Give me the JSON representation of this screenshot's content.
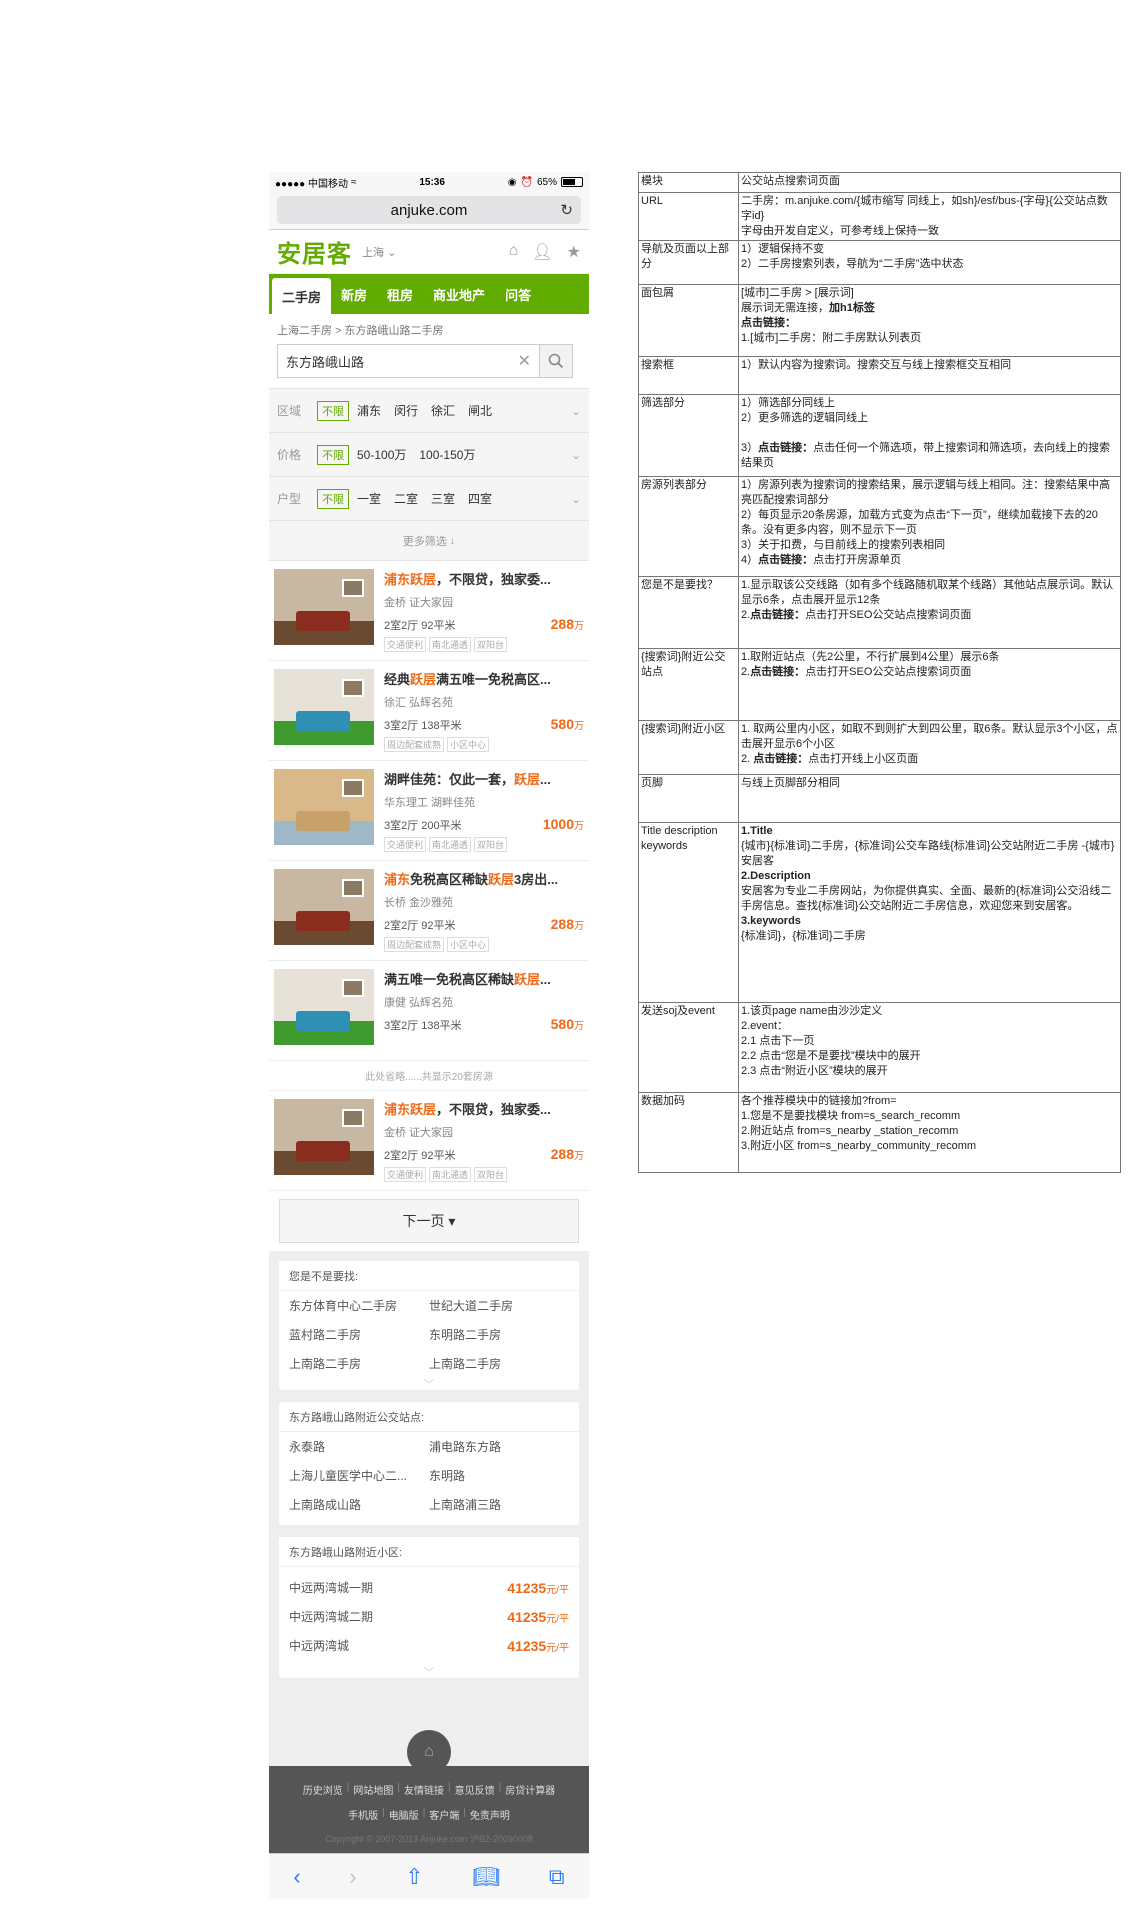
{
  "status": {
    "carrier": "●●●●● 中国移动",
    "time": "15:36",
    "battery": "65%",
    "battery_level": 0.65
  },
  "browser": {
    "url": "anjuke.com"
  },
  "site": {
    "logo": "安居客",
    "city": "上海"
  },
  "nav": {
    "tabs": [
      "二手房",
      "新房",
      "租房",
      "商业地产",
      "问答"
    ],
    "active": 0
  },
  "breadcrumb": "上海二手房 > 东方路峨山路二手房",
  "search": {
    "value": "东方路峨山路"
  },
  "filters": [
    {
      "label": "区域",
      "all": "不限",
      "options": [
        "浦东",
        "闵行",
        "徐汇",
        "闸北"
      ]
    },
    {
      "label": "价格",
      "all": "不限",
      "options": [
        "50-100万",
        "100-150万"
      ]
    },
    {
      "label": "户型",
      "all": "不限",
      "options": [
        "一室",
        "二室",
        "三室",
        "四室"
      ]
    }
  ],
  "more_filters": "更多筛选",
  "listings": [
    {
      "title_hl": "浦东跃层",
      "title_rest": "，不限贷，独家委...",
      "community": "金桥  证大家园",
      "specs": "2室2厅   92平米",
      "price": "288",
      "unit": "万",
      "tags": [
        "交通便利",
        "南北通透",
        "双阳台"
      ],
      "scene": "a"
    },
    {
      "title_pre": "经典",
      "title_hl": "跃层",
      "title_rest": "满五唯一免税高区...",
      "community": "徐汇  弘辉名苑",
      "specs": "3室2厅   138平米",
      "price": "580",
      "unit": "万",
      "tags": [
        "周边配套成熟",
        "小区中心"
      ],
      "scene": "b"
    },
    {
      "title_pre": "湖畔佳苑：仅此一套，",
      "title_hl": "跃层",
      "title_rest": "...",
      "community": "华东理工  湖畔佳苑",
      "specs": "3室2厅   200平米",
      "price": "1000",
      "unit": "万",
      "tags": [
        "交通便利",
        "南北通透",
        "双阳台"
      ],
      "scene": "c"
    },
    {
      "title_hl": "浦东",
      "title_rest": "免税高区稀缺",
      "title_hl2": "跃层",
      "title_rest2": "3房出...",
      "community": "长桥  金沙雅苑",
      "specs": "2室2厅   92平米",
      "price": "288",
      "unit": "万",
      "tags": [
        "周边配套成熟",
        "小区中心"
      ],
      "scene": "a"
    },
    {
      "title_pre": "满五唯一免税高区稀缺",
      "title_hl": "跃层",
      "title_rest": "...",
      "community": "康健  弘辉名苑",
      "specs": "3室2厅   138平米",
      "price": "580",
      "unit": "万",
      "tags": [],
      "scene": "b"
    }
  ],
  "omit_note": "此处省略......共显示20套房源",
  "last_listing": {
    "title_hl": "浦东跃层",
    "title_rest": "，不限贷，独家委...",
    "community": "金桥  证大家园",
    "specs": "2室2厅   92平米",
    "price": "288",
    "unit": "万",
    "tags": [
      "交通便利",
      "南北通透",
      "双阳台"
    ],
    "scene": "a"
  },
  "next_page": "下一页 ▾",
  "rec1": {
    "title": "您是不是要找:",
    "items": [
      "东方体育中心二手房",
      "世纪大道二手房",
      "蓝村路二手房",
      "东明路二手房",
      "上南路二手房",
      "上南路二手房"
    ]
  },
  "rec2": {
    "title": "东方路峨山路附近公交站点:",
    "items": [
      "永泰路",
      "浦电路东方路",
      "上海儿童医学中心二...",
      "东明路",
      "上南路成山路",
      "上南路浦三路"
    ]
  },
  "rec3": {
    "title": "东方路峨山路附近小区:",
    "items": [
      {
        "name": "中远两湾城一期",
        "price": "41235",
        "unit": "元/平"
      },
      {
        "name": "中远两湾城二期",
        "price": "41235",
        "unit": "元/平"
      },
      {
        "name": "中远两湾城",
        "price": "41235",
        "unit": "元/平"
      }
    ]
  },
  "footer": {
    "row1": [
      "历史浏览",
      "网站地图",
      "友情链接",
      "意见反馈",
      "房贷计算器"
    ],
    "row2": [
      "手机版",
      "电脑版",
      "客户端",
      "免责声明"
    ],
    "copyright": "Copyright © 2007-2013 Anjuke.com  沪B2-20090008"
  },
  "spec": [
    {
      "k": "模块",
      "v": [
        "公交站点搜索词页面"
      ]
    },
    {
      "k": "URL",
      "v": [
        "二手房：m.anjuke.com/{城市缩写 同线上，如sh}/esf/bus-{字母}{公交站点数字id}",
        "字母由开发自定义，可参考线上保持一致"
      ]
    },
    {
      "k": "导航及页面以上部分",
      "v": [
        "1）逻辑保持不变",
        "2）二手房搜索列表，导航为“二手房”选中状态"
      ]
    },
    {
      "k": "面包屑",
      "v": [
        "[城市]二手房 > [展示词]",
        "展示词无需连接，|加h1标签",
        "|点击链接：",
        "1.[城市]二手房：附二手房默认列表页"
      ]
    },
    {
      "k": "搜索框",
      "v": [
        "1）默认内容为搜索词。搜索交互与线上搜索框交互相同"
      ]
    },
    {
      "k": "筛选部分",
      "v": [
        "1）筛选部分同线上",
        "2）更多筛选的逻辑同线上",
        "",
        "3）|点击链接：点击任何一个筛选项，带上搜索词和筛选项，去向线上的搜索结果页"
      ]
    },
    {
      "k": "房源列表部分",
      "v": [
        "1）房源列表为搜索词的搜索结果，展示逻辑与线上相同。注：搜索结果中高亮匹配搜索词部分",
        "2）每页显示20条房源，加载方式变为点击“下一页”，继续加载接下去的20条。没有更多内容，则不显示下一页",
        "3）关于扣费，与目前线上的搜索列表相同",
        "4）|点击链接：点击打开房源单页"
      ]
    },
    {
      "k": "您是不是要找？",
      "v": [
        "1.显示取该公交线路（如有多个线路随机取某个线路）其他站点展示词。默认显示6条，点击展开显示12条",
        "2.|点击链接：点击打开SEO公交站点搜索词页面"
      ]
    },
    {
      "k": "{搜索词}附近公交站点",
      "v": [
        "1.取附近站点（先2公里，不行扩展到4公里）展示6条",
        "2.|点击链接：点击打开SEO公交站点搜索词页面"
      ]
    },
    {
      "k": "{搜索词}附近小区",
      "v": [
        "1. 取两公里内小区，如取不到则扩大到四公里，取6条。默认显示3个小区，点击展开显示6个小区",
        "2. |点击链接：点击打开线上小区页面"
      ]
    },
    {
      "k": "页脚",
      "v": [
        "与线上页脚部分相同"
      ]
    },
    {
      "k": "Title description keywords",
      "v": [
        "|1.Title",
        "{城市}{标准词}二手房，{标准词}公交车路线{标准词}公交站附近二手房 -{城市}安居客",
        "|2.Description",
        "安居客为专业二手房网站，为你提供真实、全面、最新的{标准词}公交沿线二手房信息。查找{标准词}公交站附近二手房信息，欢迎您来到安居客。",
        "|3.keywords",
        "{标准词}，{标准词}二手房"
      ]
    },
    {
      "k": "发送soj及event",
      "v": [
        "1.该页page name由沙沙定义",
        "2.event：",
        "2.1 点击下一页",
        "2.2 点击“您是不是要找”模块中的展开",
        "2.3 点击“附近小区”模块的展开"
      ]
    },
    {
      "k": "数据加码",
      "v": [
        "各个推荐模块中的链接加?from=",
        "1.您是不是要找模块 from=s_search_recomm",
        "2.附近站点 from=s_nearby _station_recomm",
        "3.附近小区 from=s_nearby_community_recomm"
      ]
    }
  ]
}
